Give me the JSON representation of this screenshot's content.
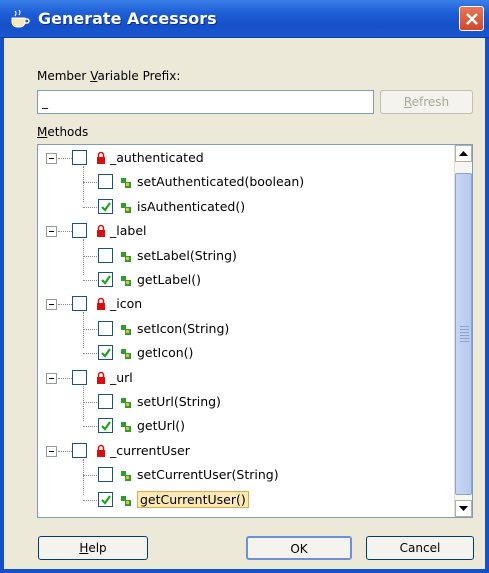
{
  "window": {
    "title": "Generate Accessors"
  },
  "prefix": {
    "label": "Member Variable Prefix:",
    "label_mnemonic": "V",
    "value": "_",
    "refresh_label": "Refresh"
  },
  "methods": {
    "label": "Methods",
    "fields": [
      {
        "name": "_authenticated",
        "checked": false,
        "methods": [
          {
            "name": "setAuthenticated(boolean)",
            "checked": false
          },
          {
            "name": "isAuthenticated()",
            "checked": true
          }
        ]
      },
      {
        "name": "_label",
        "checked": false,
        "methods": [
          {
            "name": "setLabel(String)",
            "checked": false
          },
          {
            "name": "getLabel()",
            "checked": true
          }
        ]
      },
      {
        "name": "_icon",
        "checked": false,
        "methods": [
          {
            "name": "setIcon(String)",
            "checked": false
          },
          {
            "name": "getIcon()",
            "checked": true
          }
        ]
      },
      {
        "name": "_url",
        "checked": false,
        "methods": [
          {
            "name": "setUrl(String)",
            "checked": false
          },
          {
            "name": "getUrl()",
            "checked": true
          }
        ]
      },
      {
        "name": "_currentUser",
        "checked": false,
        "methods": [
          {
            "name": "setCurrentUser(String)",
            "checked": false
          },
          {
            "name": "getCurrentUser()",
            "checked": true,
            "selected": true
          }
        ]
      }
    ]
  },
  "buttons": {
    "help": "Help",
    "ok": "OK",
    "cancel": "Cancel"
  },
  "colors": {
    "title_bar": "#1d5ed6",
    "dialog_bg": "#ece9d8",
    "field_icon": "#d80f0f",
    "method_icon": "#2e9c2e"
  }
}
